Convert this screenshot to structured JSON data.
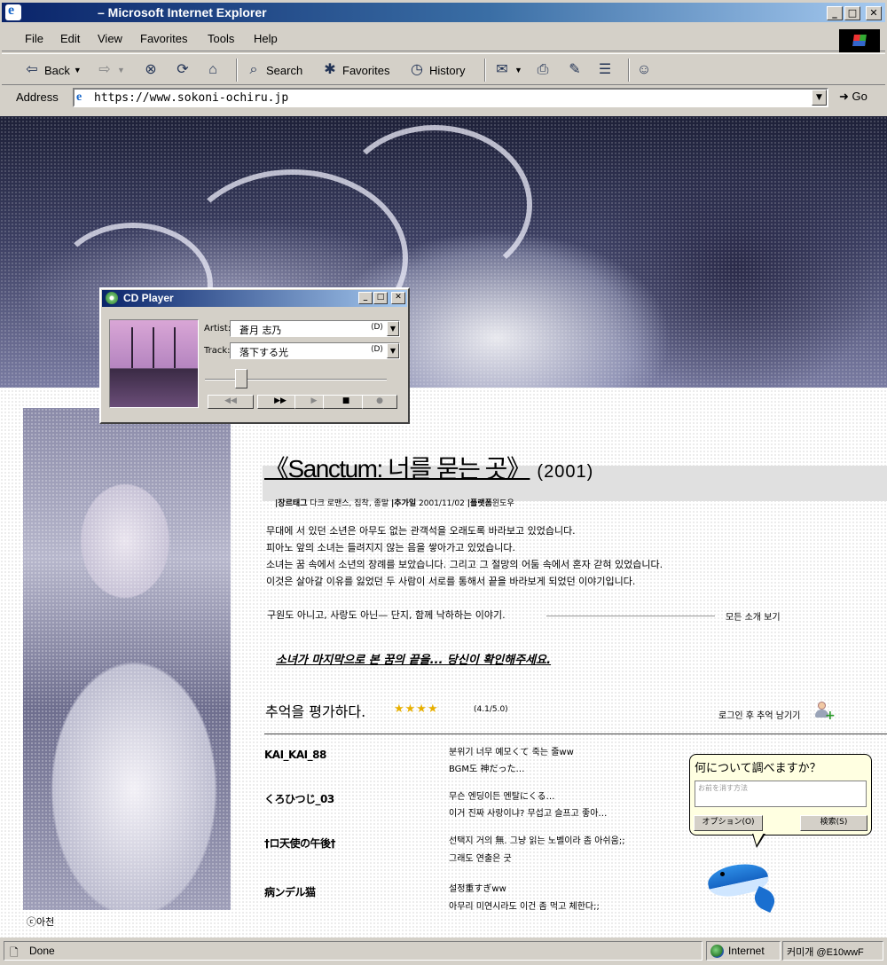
{
  "window": {
    "title": "– Microsoft Internet Explorer",
    "controls": [
      "_",
      "□",
      "✕"
    ]
  },
  "menu": [
    "File",
    "Edit",
    "View",
    "Favorites",
    "Tools",
    "Help"
  ],
  "toolbar": {
    "back": "Back",
    "search": "Search",
    "favorites": "Favorites",
    "history": "History"
  },
  "address": {
    "label": "Address",
    "url": "https://www.sokoni-ochiru.jp",
    "go": "Go"
  },
  "cd_player": {
    "title": "CD Player",
    "artist_label": "Artist:",
    "artist": "蒼月 志乃",
    "track_label": "Track:",
    "track": "落下する光",
    "progress": 0.18,
    "buttons": [
      "◀◀",
      "▶▶",
      "▶",
      "■",
      "●"
    ]
  },
  "game": {
    "title": "《Sanctum: 너를 묻는 곳》",
    "year": "(2001)",
    "meta_genre_label": "|장르태그",
    "meta_genre": "다크 로맨스, 집착, 종말",
    "meta_date_label": "|추가일",
    "meta_date": "2001/11/02",
    "meta_platform_label": "|플랫폼",
    "meta_platform": "윈도우",
    "description": [
      "무대에 서 있던 소년은 아무도 없는 관객석을 오래도록 바라보고 있었습니다.",
      "피아노 앞의 소녀는 들려지지 않는 음을 쌓아가고 있었습니다.",
      "소녀는 꿈 속에서 소년의 장례를 보았습니다. 그리고 그 절망의 어둠 속에서 혼자 갇혀 있었습니다.",
      "이것은 살아갈 이유를 잃었던 두 사람이 서로를 통해서 끝을 바라보게 되었던 이야기입니다."
    ],
    "tagline": "구원도 아니고, 사랑도 아닌— 단지, 함께 낙하하는 이야기.",
    "view_all": "모든 소개 보기",
    "teaser": "소녀가 마지막으로 본 꿈의 끝을... 당신이 확인해주세요.",
    "portrait_credit": "ⓒ아천"
  },
  "rating": {
    "label": "추억을 평가하다.",
    "stars": "★★★★",
    "score": "(4.1/5.0)",
    "login_cta": "로그인 후 추억 남기기"
  },
  "comments": [
    {
      "user": "KAI_KAI_88",
      "lines": [
        "분위기 너무 예모くて 죽는 줄ww",
        "BGM도 神だった…"
      ]
    },
    {
      "user": "くろひつじ_03",
      "lines": [
        "무슨 엔딩이든 멘탈にくる…",
        "이거 진짜 사랑이냐? 무섭고 슬프고 좋아…"
      ]
    },
    {
      "user": "†ロ天使の午後†",
      "lines": [
        "선택지 거의 無. 그냥 읽는 노벨이라 좀 아쉬움;;",
        "그래도 연출은 굿"
      ]
    },
    {
      "user": "病ンデル猫",
      "lines": [
        "설정重すぎww",
        "아무리 미연시라도 이건 좀 먹고 체한다;;"
      ]
    }
  ],
  "assistant": {
    "question": "何について調べますか？",
    "placeholder": "お前を消す方法",
    "options": "オプション(O)",
    "search": "検索(S)"
  },
  "status": {
    "text": "Done",
    "zone": "Internet",
    "user": "커미개 @E10wwF"
  }
}
